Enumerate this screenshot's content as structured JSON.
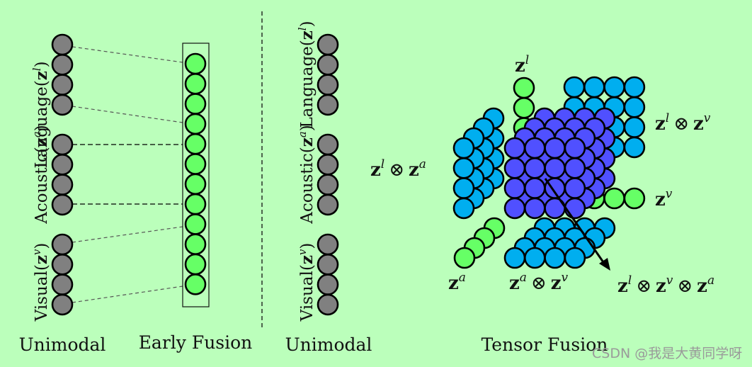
{
  "colors": {
    "background": "#bbffbb",
    "unimodal_node": "#808080",
    "early_fusion_node": "#66ff66",
    "bimodal_node": "#00aeef",
    "trimodal_node": "#5050ff",
    "unimodal_vector_node": "#66ff66"
  },
  "left_panel": {
    "modalities": [
      {
        "name": "Language",
        "var": "z",
        "sup": "l",
        "nodes": 4
      },
      {
        "name": "Acoustic",
        "var": "z",
        "sup": "a",
        "nodes": 4
      },
      {
        "name": "Visual",
        "var": "z",
        "sup": "v",
        "nodes": 4
      }
    ],
    "early_fusion_nodes": 12,
    "caption_unimodal": "Unimodal",
    "caption_early_fusion": "Early Fusion"
  },
  "right_panel": {
    "modalities": [
      {
        "name": "Language",
        "var": "z",
        "sup": "l",
        "nodes": 4
      },
      {
        "name": "Acoustic",
        "var": "z",
        "sup": "a",
        "nodes": 4
      },
      {
        "name": "Visual",
        "var": "z",
        "sup": "v",
        "nodes": 4
      }
    ],
    "caption_unimodal": "Unimodal",
    "caption_tensor_fusion": "Tensor Fusion",
    "labels": {
      "zl": {
        "base": "z",
        "sup": "l"
      },
      "za": {
        "base": "z",
        "sup": "a"
      },
      "zv": {
        "base": "z",
        "sup": "v"
      },
      "zl_zv": {
        "a": "l",
        "b": "v",
        "op": "⊗"
      },
      "zl_za": {
        "a": "l",
        "b": "a",
        "op": "⊗"
      },
      "za_zv": {
        "a": "a",
        "b": "v",
        "op": "⊗"
      },
      "zl_zv_za": {
        "a": "l",
        "b": "v",
        "c": "a",
        "op": "⊗"
      }
    }
  },
  "watermark": "CSDN @我是大黄同学呀"
}
